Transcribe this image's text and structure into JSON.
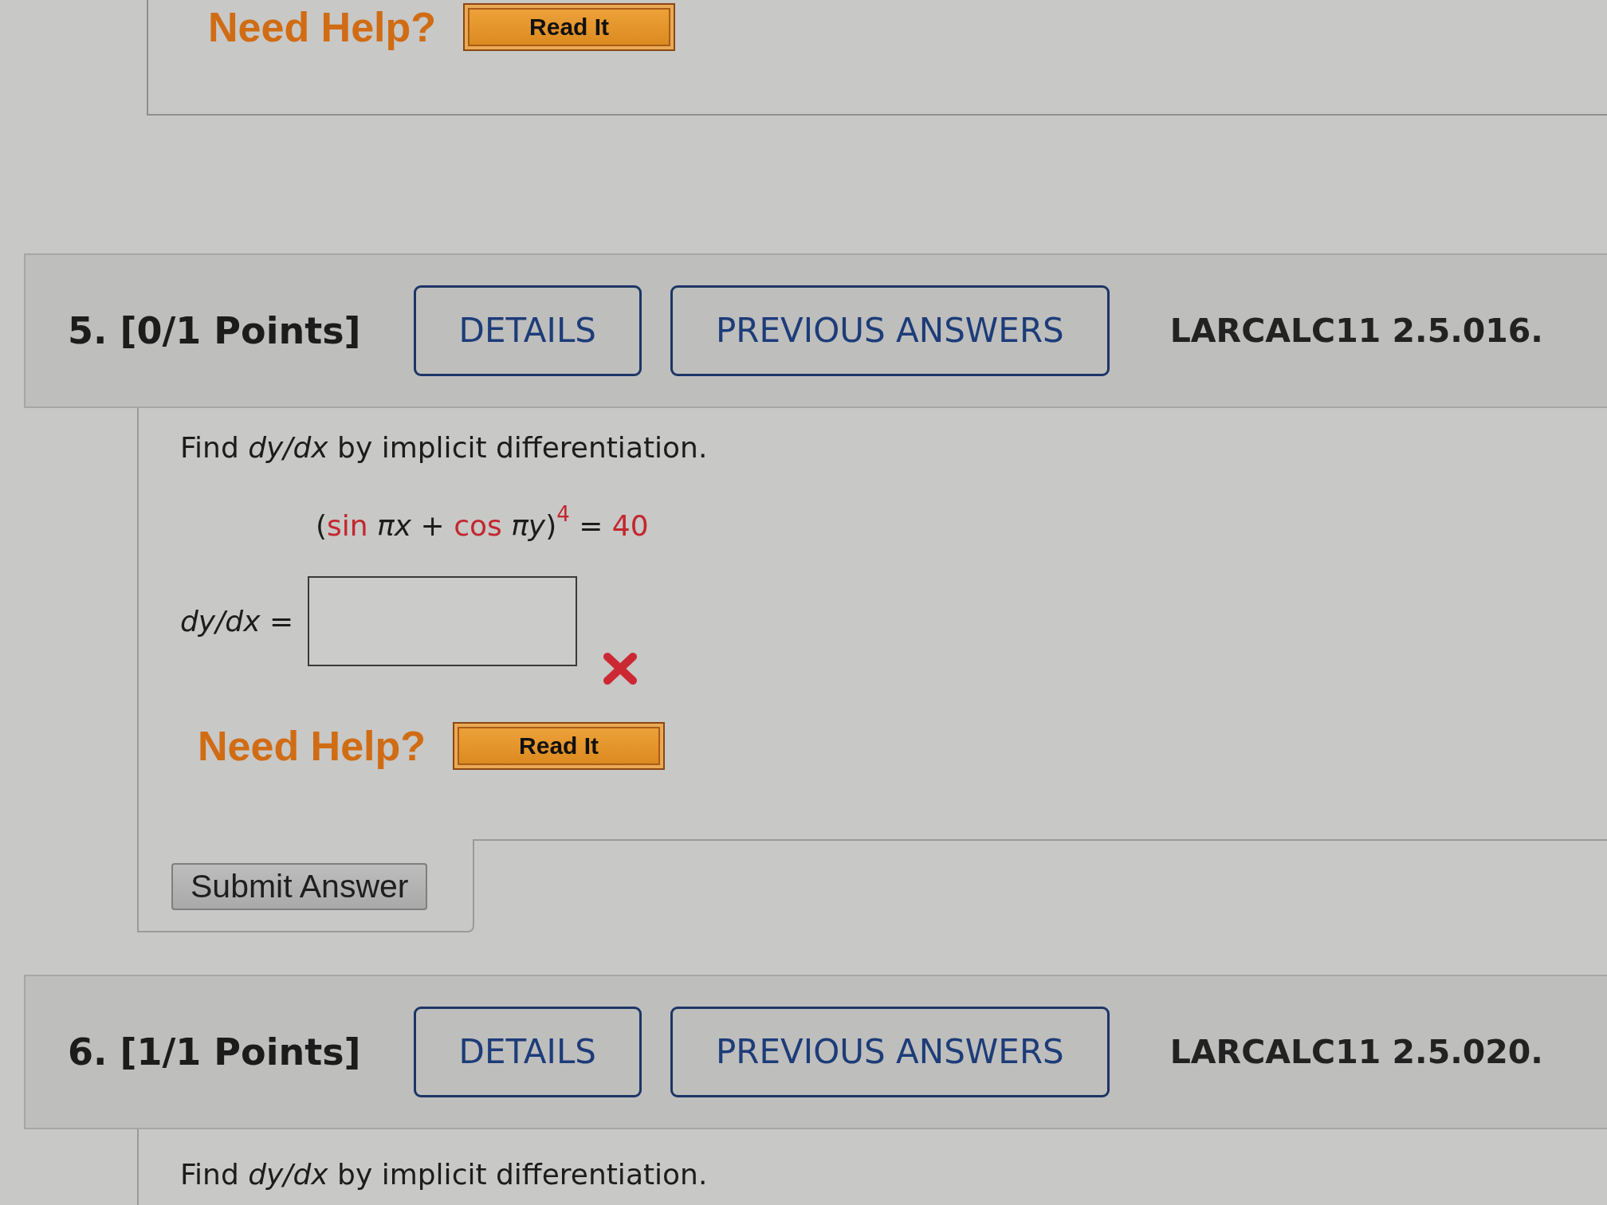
{
  "previous_question": {
    "help_label": "Need Help?",
    "help_buttons": [
      "Read It"
    ]
  },
  "questions": [
    {
      "title": "5. [0/1 Points]",
      "buttons": [
        "DETAILS",
        "PREVIOUS ANSWERS"
      ],
      "source": "LARCALC11 2.5.016.",
      "prompt": "Find *dy/dx* by implicit differentiation.",
      "equation": [
        {
          "kind": "plain",
          "text": "("
        },
        {
          "kind": "given",
          "text": "sin"
        },
        {
          "kind": "plain",
          "text": " *πx* + "
        },
        {
          "kind": "given",
          "text": "cos"
        },
        {
          "kind": "plain",
          "text": " *πy*)"
        },
        {
          "kind": "power",
          "text": "4"
        },
        {
          "kind": "plain",
          "text": " = "
        },
        {
          "kind": "given",
          "text": "40"
        }
      ],
      "answer": {
        "label": "*dy/dx* =",
        "correct": false
      },
      "help_label": "Need Help?",
      "help_buttons": [
        "Read It"
      ],
      "submit": "Submit Answer"
    },
    {
      "title": "6. [1/1 Points]",
      "buttons": [
        "DETAILS",
        "PREVIOUS ANSWERS"
      ],
      "source": "LARCALC11 2.5.020.",
      "prompt": "Find *dy/dx* by implicit differentiation."
    }
  ]
}
